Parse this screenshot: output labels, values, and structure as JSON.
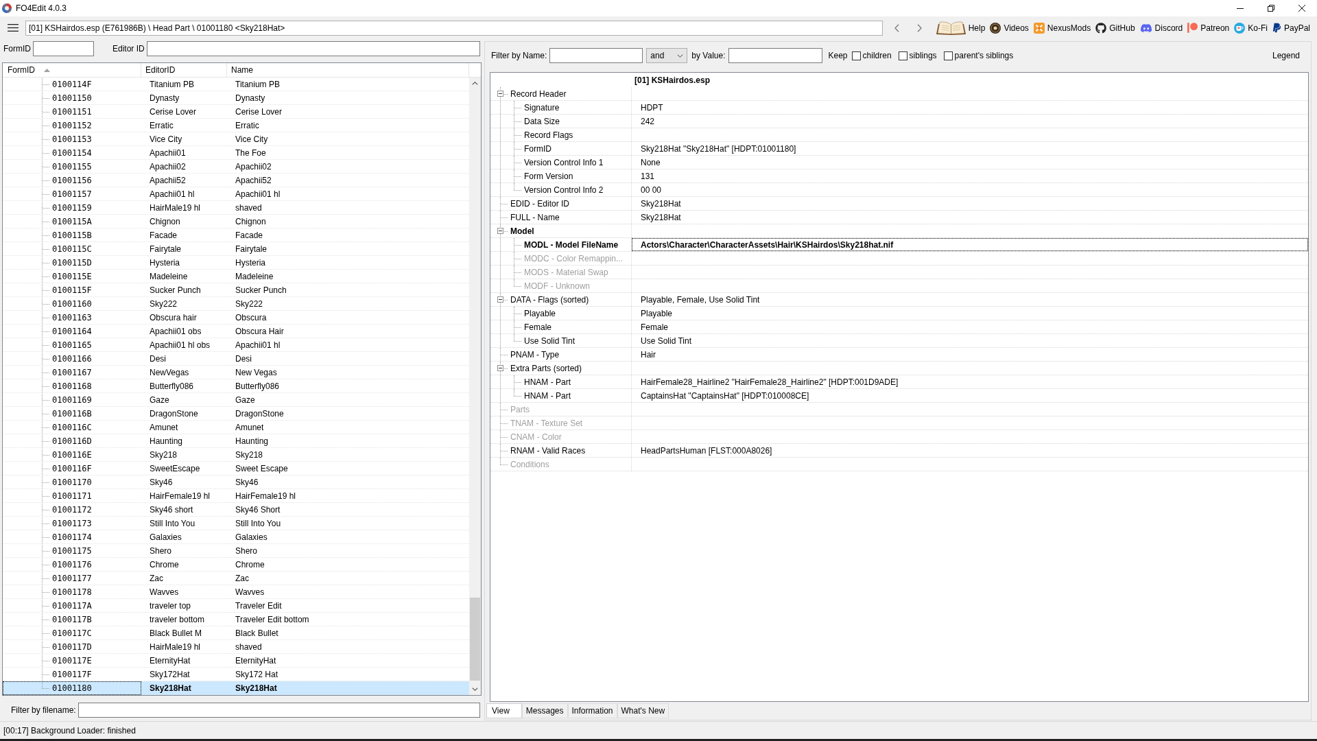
{
  "window": {
    "title": "FO4Edit 4.0.3"
  },
  "toolbar": {
    "path": "[01] KSHairdos.esp (E761986B) \\ Head Part \\ 01001180 <Sky218Hat>",
    "links": [
      {
        "label": "Help"
      },
      {
        "label": "Videos"
      },
      {
        "label": "NexusMods"
      },
      {
        "label": "GitHub"
      },
      {
        "label": "Discord"
      },
      {
        "label": "Patreon"
      },
      {
        "label": "Ko-Fi"
      },
      {
        "label": "PayPal"
      }
    ]
  },
  "record_list": {
    "filters": [
      {
        "label": "FormID"
      },
      {
        "label": "Editor ID"
      }
    ],
    "columns": [
      {
        "label": "FormID",
        "sorted": true
      },
      {
        "label": "EditorID",
        "sorted": false
      },
      {
        "label": "Name",
        "sorted": false
      }
    ],
    "rows": [
      {
        "form_id": "0100114F",
        "editor_id": "Titanium PB",
        "name": "Titanium PB",
        "selected": false
      },
      {
        "form_id": "01001150",
        "editor_id": "Dynasty",
        "name": "Dynasty",
        "selected": false
      },
      {
        "form_id": "01001151",
        "editor_id": "Cerise Lover",
        "name": "Cerise Lover",
        "selected": false
      },
      {
        "form_id": "01001152",
        "editor_id": "Erratic",
        "name": "Erratic",
        "selected": false
      },
      {
        "form_id": "01001153",
        "editor_id": "Vice City",
        "name": "Vice City",
        "selected": false
      },
      {
        "form_id": "01001154",
        "editor_id": "Apachii01",
        "name": "The Foe",
        "selected": false
      },
      {
        "form_id": "01001155",
        "editor_id": "Apachii02",
        "name": "Apachii02",
        "selected": false
      },
      {
        "form_id": "01001156",
        "editor_id": "Apachii52",
        "name": "Apachii52",
        "selected": false
      },
      {
        "form_id": "01001157",
        "editor_id": "Apachii01 hl",
        "name": "Apachii01 hl",
        "selected": false
      },
      {
        "form_id": "01001159",
        "editor_id": "HairMale19 hl",
        "name": "shaved",
        "selected": false
      },
      {
        "form_id": "0100115A",
        "editor_id": "Chignon",
        "name": "Chignon",
        "selected": false
      },
      {
        "form_id": "0100115B",
        "editor_id": "Facade",
        "name": "Facade",
        "selected": false
      },
      {
        "form_id": "0100115C",
        "editor_id": "Fairytale",
        "name": "Fairytale",
        "selected": false
      },
      {
        "form_id": "0100115D",
        "editor_id": "Hysteria",
        "name": "Hysteria",
        "selected": false
      },
      {
        "form_id": "0100115E",
        "editor_id": "Madeleine",
        "name": "Madeleine",
        "selected": false
      },
      {
        "form_id": "0100115F",
        "editor_id": "Sucker Punch",
        "name": "Sucker Punch",
        "selected": false
      },
      {
        "form_id": "01001160",
        "editor_id": "Sky222",
        "name": "Sky222",
        "selected": false
      },
      {
        "form_id": "01001163",
        "editor_id": "Obscura hair",
        "name": "Obscura",
        "selected": false
      },
      {
        "form_id": "01001164",
        "editor_id": "Apachii01 obs",
        "name": "Obscura Hair",
        "selected": false
      },
      {
        "form_id": "01001165",
        "editor_id": "Apachii01 hl obs",
        "name": "Apachii01 hl",
        "selected": false
      },
      {
        "form_id": "01001166",
        "editor_id": "Desi",
        "name": "Desi",
        "selected": false
      },
      {
        "form_id": "01001167",
        "editor_id": "NewVegas",
        "name": "New Vegas",
        "selected": false
      },
      {
        "form_id": "01001168",
        "editor_id": "Butterfly086",
        "name": "Butterfly086",
        "selected": false
      },
      {
        "form_id": "01001169",
        "editor_id": "Gaze",
        "name": "Gaze",
        "selected": false
      },
      {
        "form_id": "0100116B",
        "editor_id": "DragonStone",
        "name": "DragonStone",
        "selected": false
      },
      {
        "form_id": "0100116C",
        "editor_id": "Amunet",
        "name": "Amunet",
        "selected": false
      },
      {
        "form_id": "0100116D",
        "editor_id": "Haunting",
        "name": "Haunting",
        "selected": false
      },
      {
        "form_id": "0100116E",
        "editor_id": "Sky218",
        "name": "Sky218",
        "selected": false
      },
      {
        "form_id": "0100116F",
        "editor_id": "SweetEscape",
        "name": "Sweet Escape",
        "selected": false
      },
      {
        "form_id": "01001170",
        "editor_id": "Sky46",
        "name": "Sky46",
        "selected": false
      },
      {
        "form_id": "01001171",
        "editor_id": "HairFemale19 hl",
        "name": "HairFemale19 hl",
        "selected": false
      },
      {
        "form_id": "01001172",
        "editor_id": "Sky46 short",
        "name": "Sky46 Short",
        "selected": false
      },
      {
        "form_id": "01001173",
        "editor_id": "Still Into You",
        "name": "Still Into You",
        "selected": false
      },
      {
        "form_id": "01001174",
        "editor_id": "Galaxies",
        "name": "Galaxies",
        "selected": false
      },
      {
        "form_id": "01001175",
        "editor_id": "Shero",
        "name": "Shero",
        "selected": false
      },
      {
        "form_id": "01001176",
        "editor_id": "Chrome",
        "name": "Chrome",
        "selected": false
      },
      {
        "form_id": "01001177",
        "editor_id": "Zac",
        "name": "Zac",
        "selected": false
      },
      {
        "form_id": "01001178",
        "editor_id": "Wavves",
        "name": "Wavves",
        "selected": false
      },
      {
        "form_id": "0100117A",
        "editor_id": "traveler top",
        "name": "Traveler Edit",
        "selected": false
      },
      {
        "form_id": "0100117B",
        "editor_id": "traveler bottom",
        "name": "Traveler Edit bottom",
        "selected": false
      },
      {
        "form_id": "0100117C",
        "editor_id": "Black Bullet M",
        "name": "Black Bullet",
        "selected": false
      },
      {
        "form_id": "0100117D",
        "editor_id": "HairMale19 hl",
        "name": "shaved",
        "selected": false
      },
      {
        "form_id": "0100117E",
        "editor_id": "EternityHat",
        "name": "EternityHat",
        "selected": false
      },
      {
        "form_id": "0100117F",
        "editor_id": "Sky172Hat",
        "name": "Sky172 Hat",
        "selected": false
      },
      {
        "form_id": "01001180",
        "editor_id": "Sky218Hat",
        "name": "Sky218Hat",
        "selected": true
      }
    ],
    "filename_filter": {
      "label": "Filter by filename:"
    }
  },
  "record_view": {
    "filter": {
      "name_label": "Filter by Name:",
      "operator": "and",
      "value_label": "by Value:",
      "keep_label": "Keep",
      "options": [
        {
          "label": "children",
          "checked": false
        },
        {
          "label": "siblings",
          "checked": false
        },
        {
          "label": "parent's siblings",
          "checked": false
        }
      ],
      "legend": "Legend"
    },
    "file_header": "[01] KSHairdos.esp",
    "nodes": [
      {
        "label": "Record Header",
        "expanded": true,
        "disabled": false,
        "selected": false,
        "children": [
          {
            "label": "Signature",
            "value": "HDPT",
            "disabled": false,
            "selected": false
          },
          {
            "label": "Data Size",
            "value": "242",
            "disabled": false,
            "selected": false
          },
          {
            "label": "Record Flags",
            "disabled": false,
            "selected": false
          },
          {
            "label": "FormID",
            "value": "Sky218Hat \"Sky218Hat\" [HDPT:01001180]",
            "disabled": false,
            "selected": false
          },
          {
            "label": "Version Control Info 1",
            "value": "None",
            "disabled": false,
            "selected": false
          },
          {
            "label": "Form Version",
            "value": "131",
            "disabled": false,
            "selected": false
          },
          {
            "label": "Version Control Info 2",
            "value": "00 00",
            "disabled": false,
            "selected": false
          }
        ]
      },
      {
        "label": "EDID - Editor ID",
        "value": "Sky218Hat",
        "disabled": false,
        "selected": false
      },
      {
        "label": "FULL - Name",
        "value": "Sky218Hat",
        "disabled": false,
        "selected": false
      },
      {
        "label": "Model",
        "expanded": true,
        "disabled": false,
        "selected": false,
        "children": [
          {
            "label": "MODL - Model FileName",
            "value": "Actors\\Character\\CharacterAssets\\Hair\\KSHairdos\\Sky218hat.nif",
            "disabled": false,
            "selected": true
          },
          {
            "label": "MODC - Color Remappin...",
            "disabled": true,
            "selected": false
          },
          {
            "label": "MODS - Material Swap",
            "disabled": true,
            "selected": false
          },
          {
            "label": "MODF - Unknown",
            "disabled": true,
            "selected": false
          }
        ]
      },
      {
        "label": "DATA - Flags (sorted)",
        "value": "Playable, Female, Use Solid Tint",
        "expanded": true,
        "disabled": false,
        "selected": false,
        "children": [
          {
            "label": "Playable",
            "value": "Playable",
            "disabled": false,
            "selected": false
          },
          {
            "label": "Female",
            "value": "Female",
            "disabled": false,
            "selected": false
          },
          {
            "label": "Use Solid Tint",
            "value": "Use Solid Tint",
            "disabled": false,
            "selected": false
          }
        ]
      },
      {
        "label": "PNAM - Type",
        "value": "Hair",
        "disabled": false,
        "selected": false
      },
      {
        "label": "Extra Parts (sorted)",
        "expanded": true,
        "disabled": false,
        "selected": false,
        "children": [
          {
            "label": "HNAM - Part",
            "value": "HairFemale28_Hairline2 \"HairFemale28_Hairline2\" [HDPT:001D9ADE]",
            "disabled": false,
            "selected": false
          },
          {
            "label": "HNAM - Part",
            "value": "CaptainsHat \"CaptainsHat\" [HDPT:010008CE]",
            "disabled": false,
            "selected": false
          }
        ]
      },
      {
        "label": "Parts",
        "disabled": true,
        "selected": false
      },
      {
        "label": "TNAM - Texture Set",
        "disabled": true,
        "selected": false
      },
      {
        "label": "CNAM - Color",
        "disabled": true,
        "selected": false
      },
      {
        "label": "RNAM - Valid Races",
        "value": "HeadPartsHuman [FLST:000A8026]",
        "disabled": false,
        "selected": false
      },
      {
        "label": "Conditions",
        "disabled": true,
        "selected": false
      }
    ],
    "tabs": [
      {
        "label": "View",
        "selected": true
      },
      {
        "label": "Messages",
        "selected": false
      },
      {
        "label": "Information",
        "selected": false
      },
      {
        "label": "What's New",
        "selected": false
      }
    ]
  },
  "status_bar": {
    "text": "[00:17] Background Loader: finished"
  }
}
